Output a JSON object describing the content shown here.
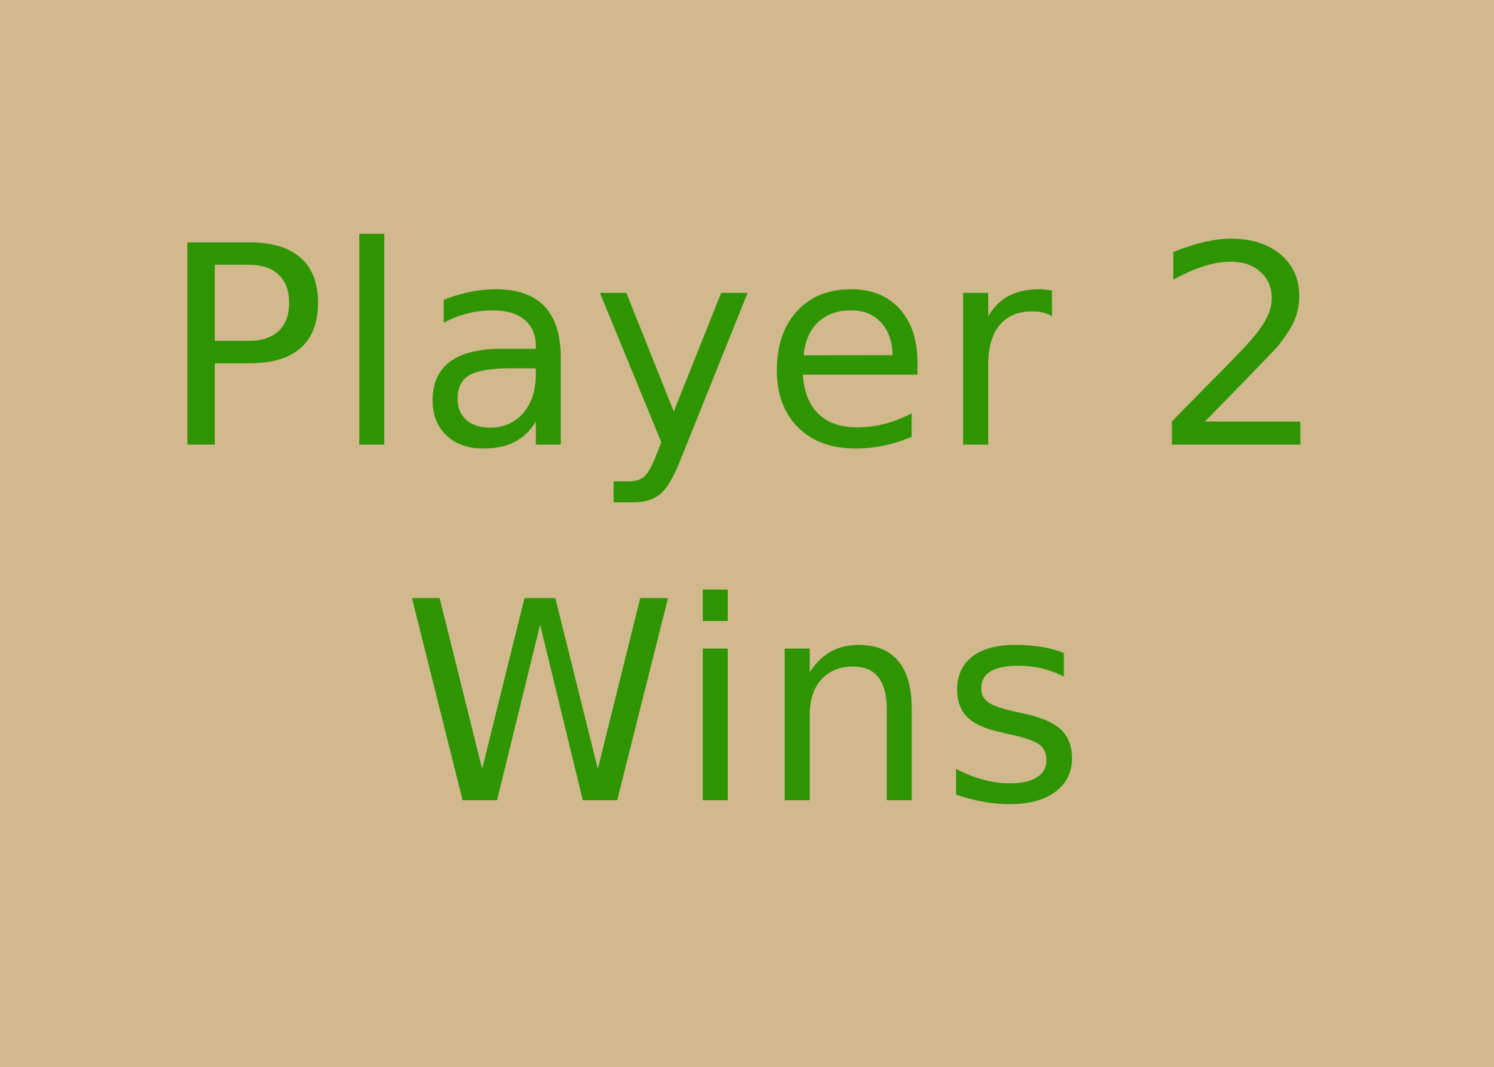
{
  "result": {
    "line1": "Player 2",
    "line2": "Wins"
  },
  "colors": {
    "background": "#d1b98d",
    "text": "#2e9400"
  }
}
